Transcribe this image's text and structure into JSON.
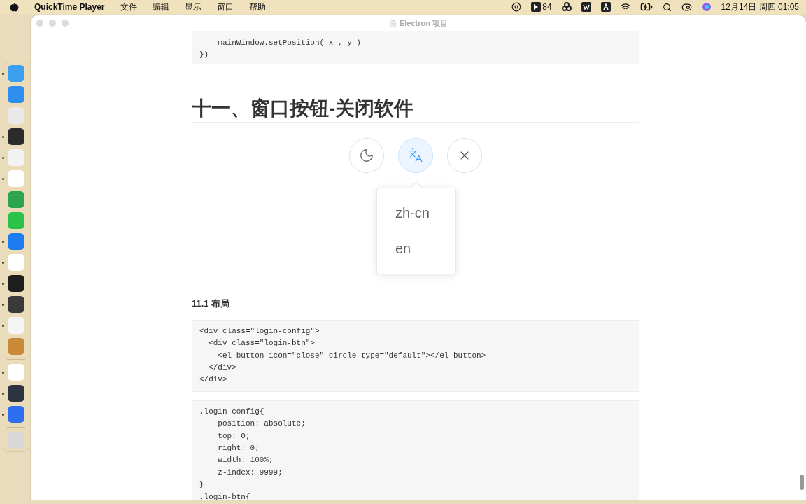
{
  "menu_bar": {
    "app_name": "QuickTime Player",
    "menus": [
      "文件",
      "编辑",
      "显示",
      "窗口",
      "帮助"
    ],
    "badge_count": "84",
    "clock": "12月14日 周四 01:05"
  },
  "dock": {
    "items": [
      {
        "kind": "app",
        "color": "#3d9ff0",
        "running": true
      },
      {
        "kind": "app",
        "color": "#2f8ff0",
        "running": false
      },
      {
        "kind": "app",
        "color": "#e8e8e8",
        "running": false
      },
      {
        "kind": "app",
        "color": "#2b2b2b",
        "running": true
      },
      {
        "kind": "app",
        "color": "#f2f2f2",
        "running": true
      },
      {
        "kind": "app",
        "color": "#ffffff",
        "running": true
      },
      {
        "kind": "app",
        "color": "#2ea44f",
        "running": false
      },
      {
        "kind": "app",
        "color": "#2ac34a",
        "running": false
      },
      {
        "kind": "app",
        "color": "#1f7cf0",
        "running": true
      },
      {
        "kind": "app",
        "color": "#ffffff",
        "running": true
      },
      {
        "kind": "app",
        "color": "#1e1e1e",
        "running": true
      },
      {
        "kind": "app",
        "color": "#3a3a3a",
        "running": true
      },
      {
        "kind": "app",
        "color": "#f5f5f5",
        "running": true
      },
      {
        "kind": "app",
        "color": "#c98a3a",
        "running": false
      },
      {
        "kind": "separator"
      },
      {
        "kind": "app",
        "color": "#ffffff",
        "running": true
      },
      {
        "kind": "app",
        "color": "#2d3440",
        "running": true
      },
      {
        "kind": "app",
        "color": "#2f6ef2",
        "running": true
      },
      {
        "kind": "separator"
      },
      {
        "kind": "app",
        "color": "#d8d8d8",
        "running": false
      }
    ]
  },
  "window": {
    "title": "Electron 项目"
  },
  "document": {
    "code_block_1": [
      "    mainWindow.setPosition( x , y )",
      "})"
    ],
    "heading": "十一、窗口按钮-关闭软件",
    "demo": {
      "buttons": [
        {
          "kind": "moon",
          "selected": false
        },
        {
          "kind": "translate",
          "selected": true
        },
        {
          "kind": "close",
          "selected": false
        }
      ],
      "popover_items": [
        "zh-cn",
        "en"
      ]
    },
    "subheading": "11.1 布局",
    "code_block_2": [
      "<div class=\"login-config\">",
      "  <div class=\"login-btn\">",
      "    <el-button icon=\"close\" circle type=\"default\"></el-button>",
      "  </div>",
      "</div>"
    ],
    "code_block_3": [
      ".login-config{",
      "    position: absolute;",
      "    top: 0;",
      "    right: 0;",
      "    width: 100%;",
      "    z-index: 9999;",
      "}",
      ".login-btn{"
    ]
  }
}
